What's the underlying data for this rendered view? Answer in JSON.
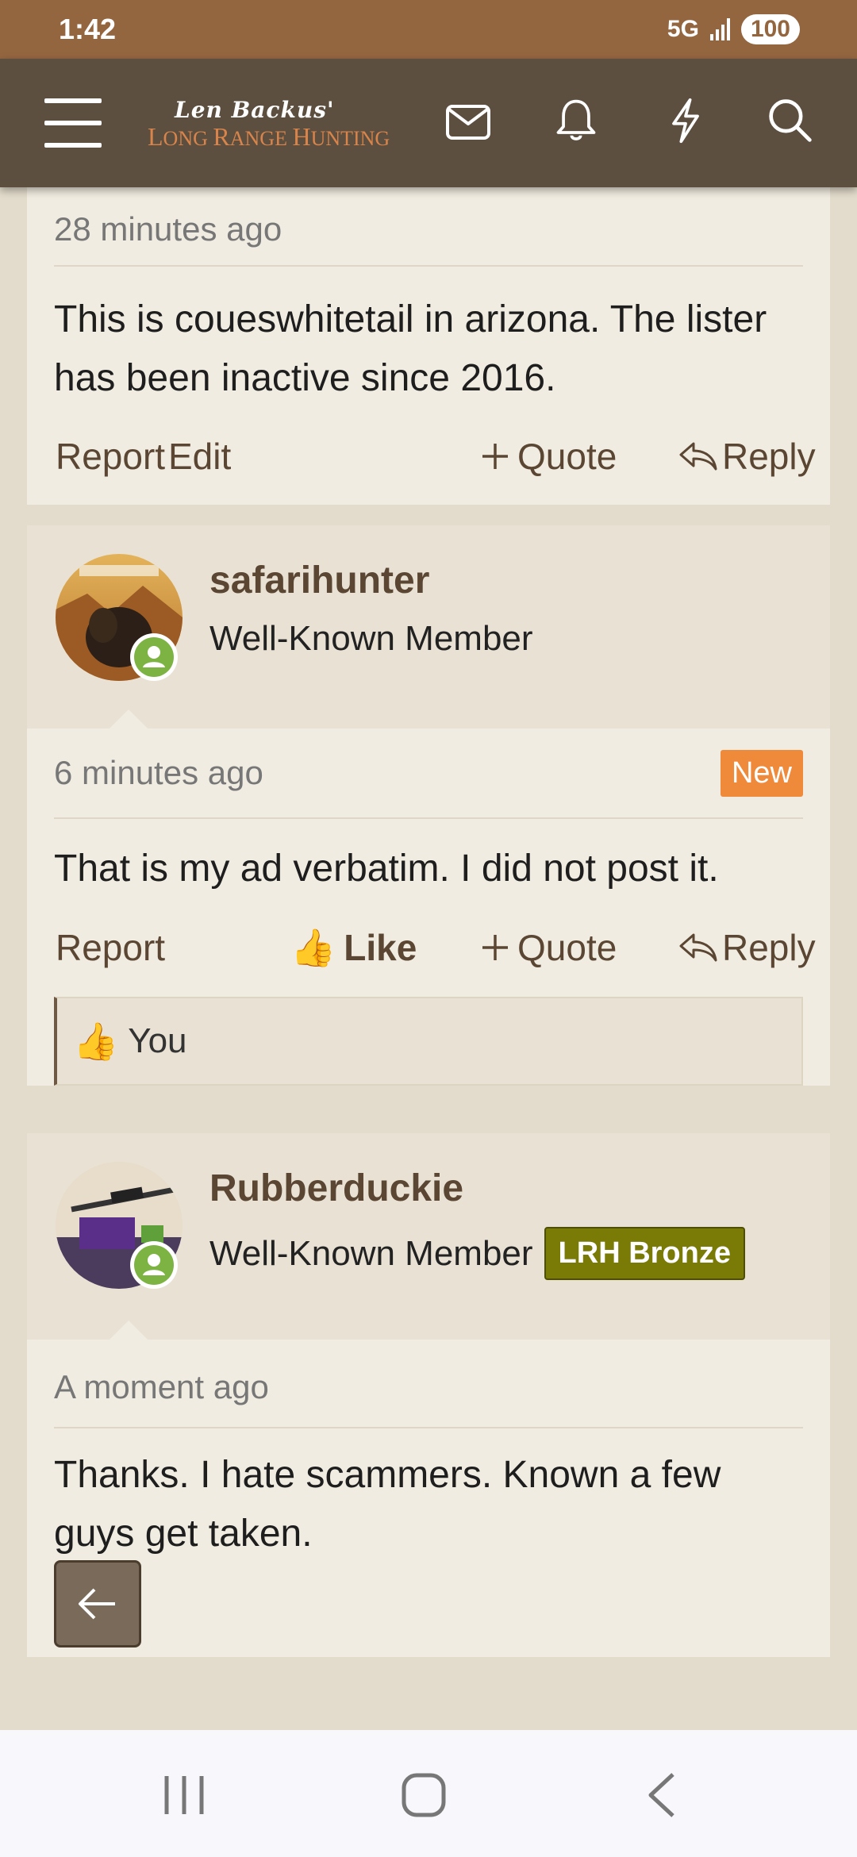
{
  "status_bar": {
    "time": "1:42",
    "network": "5G",
    "battery": "100"
  },
  "header": {
    "logo_script": "Len Backus'",
    "logo_main": "Long Range Hunting"
  },
  "posts": [
    {
      "time": "28 minutes ago",
      "message": "This is coueswhitetail in arizona. The lister has been inactive since 2016.",
      "actions": {
        "report": "Report",
        "edit": "Edit",
        "quote": "Quote",
        "reply": "Reply"
      }
    },
    {
      "username": "safarihunter",
      "user_title": "Well-Known Member",
      "time": "6 minutes ago",
      "new_badge": "New",
      "message": "That is my ad verbatim. I did not post it.",
      "actions": {
        "report": "Report",
        "like": "Like",
        "quote": "Quote",
        "reply": "Reply"
      },
      "likes": "You"
    },
    {
      "username": "Rubberduckie",
      "user_title": "Well-Known Member",
      "user_badge": "LRH Bronze",
      "time": "A moment ago",
      "message": "Thanks. I hate scammers. Known a few guys get taken."
    }
  ],
  "colors": {
    "status_bar": "#946640",
    "nav_bar": "#5d4f40",
    "post_bg": "#f1ece1",
    "user_header_bg": "#e9e2d4",
    "link_brown": "#5a4632",
    "new_orange": "#ef8a3a",
    "bronze_badge": "#7a7a07",
    "online_green": "#7cb342"
  },
  "icons": {
    "nav": [
      "menu-icon",
      "envelope-icon",
      "bell-icon",
      "lightning-icon",
      "search-icon"
    ],
    "system": [
      "recents-icon",
      "home-icon",
      "back-icon"
    ]
  }
}
